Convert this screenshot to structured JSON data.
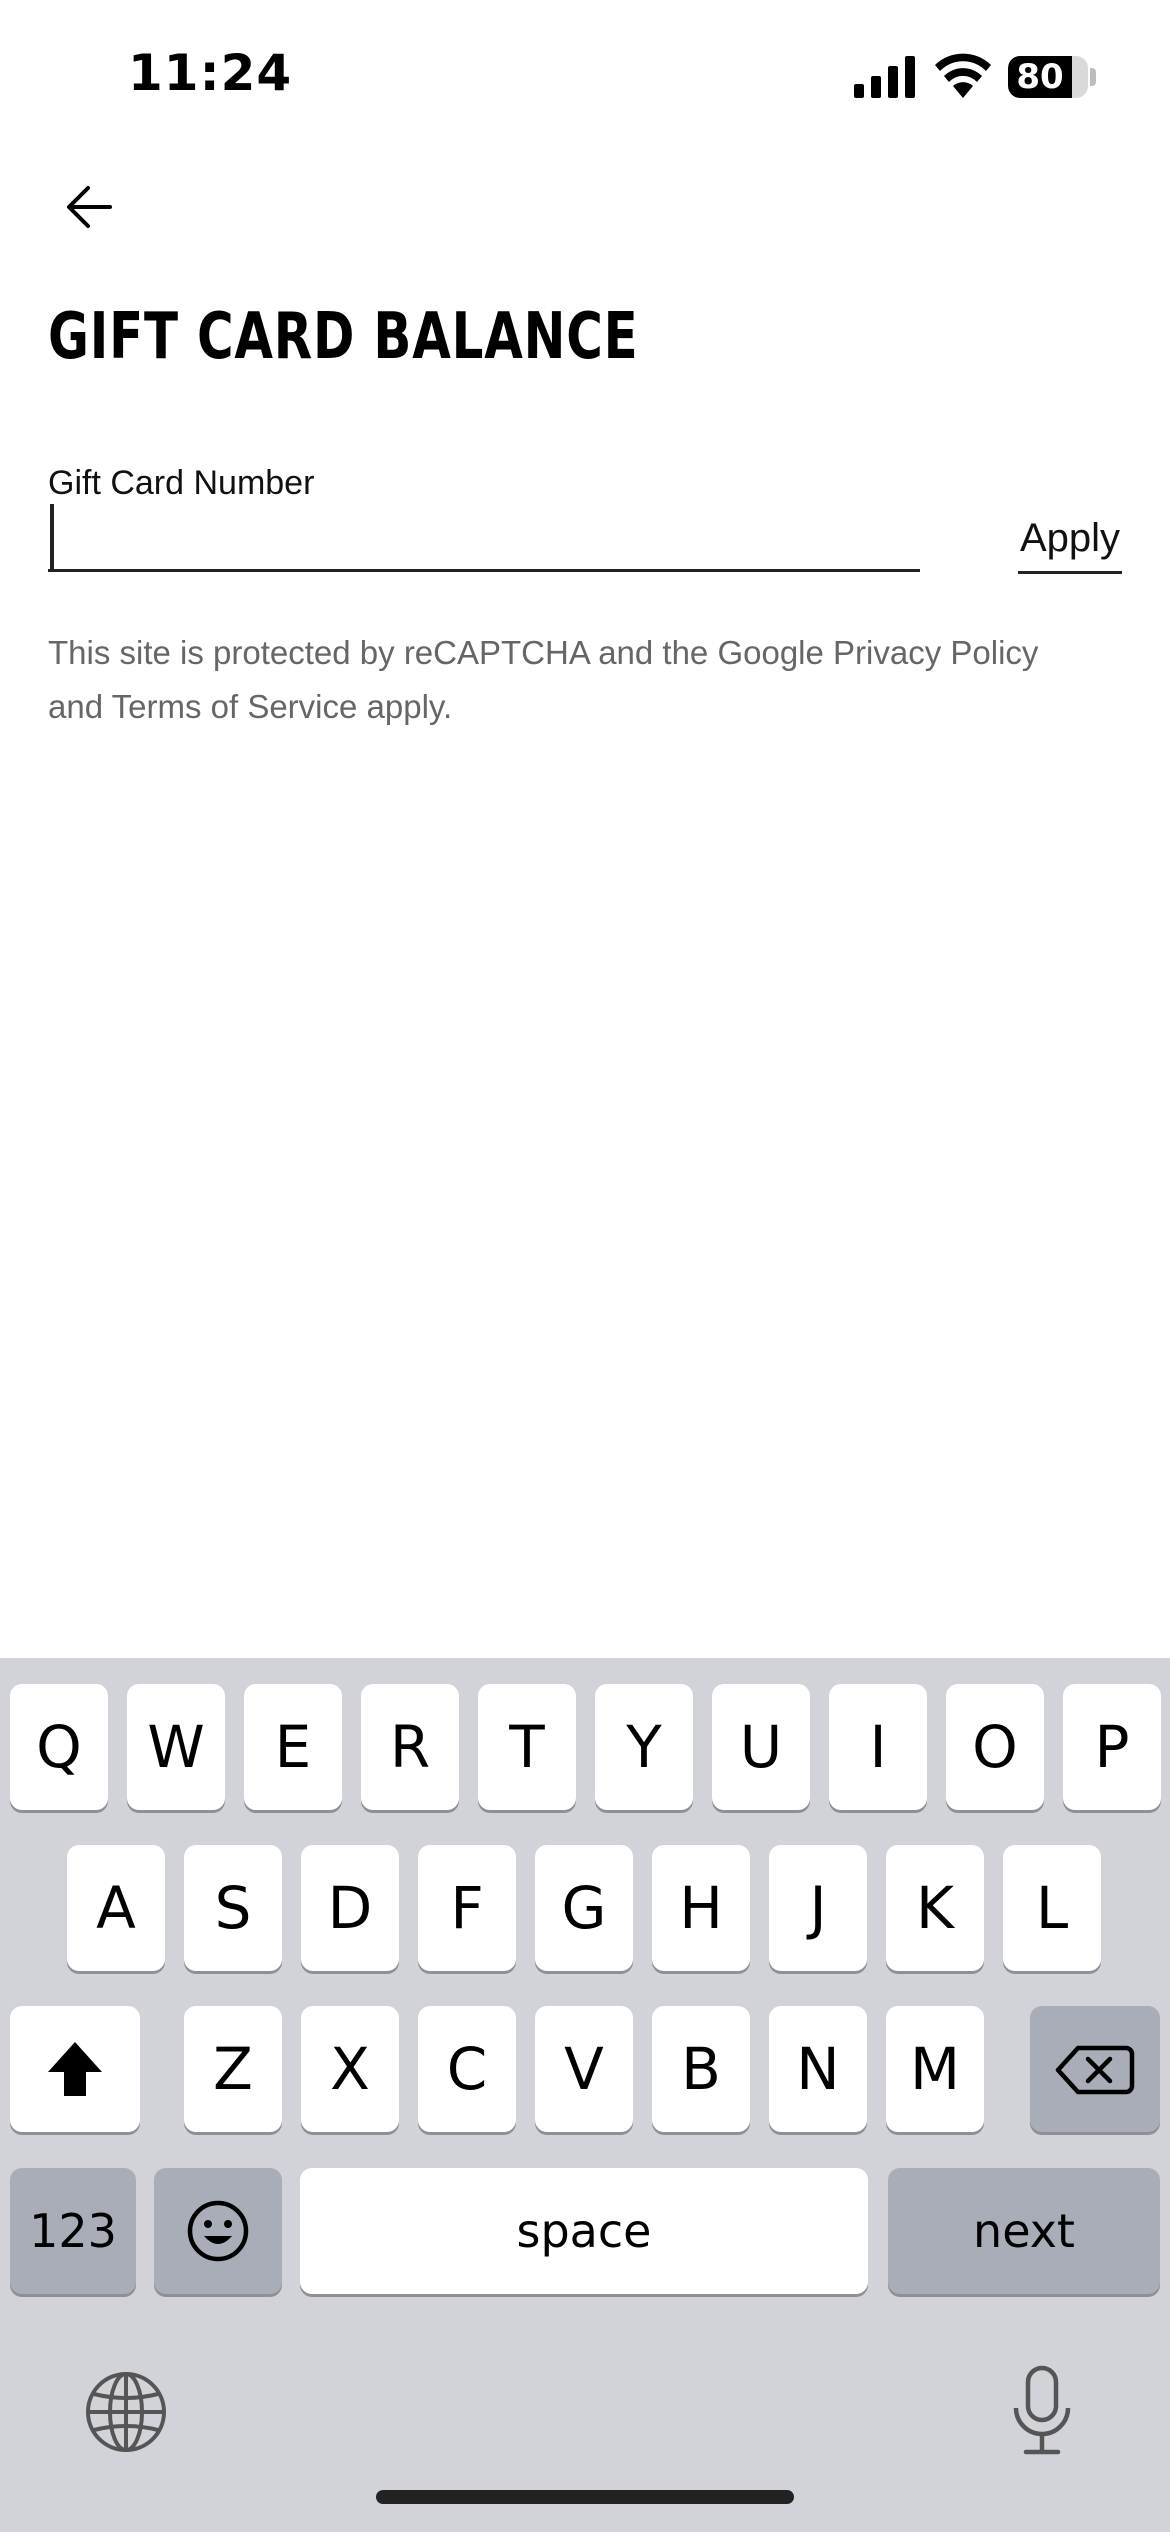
{
  "status_bar": {
    "time": "11:24",
    "battery_level": "80",
    "battery_fraction": 0.8
  },
  "header": {
    "back_icon": "arrow-left-icon",
    "title": "GIFT CARD BALANCE"
  },
  "form": {
    "field_label": "Gift Card Number",
    "input_value": "",
    "apply_label": "Apply"
  },
  "recaptcha_note": "This site is protected by reCAPTCHA and the Google Privacy Policy and Terms of Service apply.",
  "keyboard": {
    "row1": [
      "Q",
      "W",
      "E",
      "R",
      "T",
      "Y",
      "U",
      "I",
      "O",
      "P"
    ],
    "row2": [
      "A",
      "S",
      "D",
      "F",
      "G",
      "H",
      "J",
      "K",
      "L"
    ],
    "row3": [
      "Z",
      "X",
      "C",
      "V",
      "B",
      "N",
      "M"
    ],
    "shift_icon": "shift-icon",
    "delete_icon": "backspace-icon",
    "numbers_label": "123",
    "emoji_icon": "emoji-icon",
    "space_label": "space",
    "next_label": "next",
    "globe_icon": "globe-icon",
    "mic_icon": "microphone-icon"
  }
}
